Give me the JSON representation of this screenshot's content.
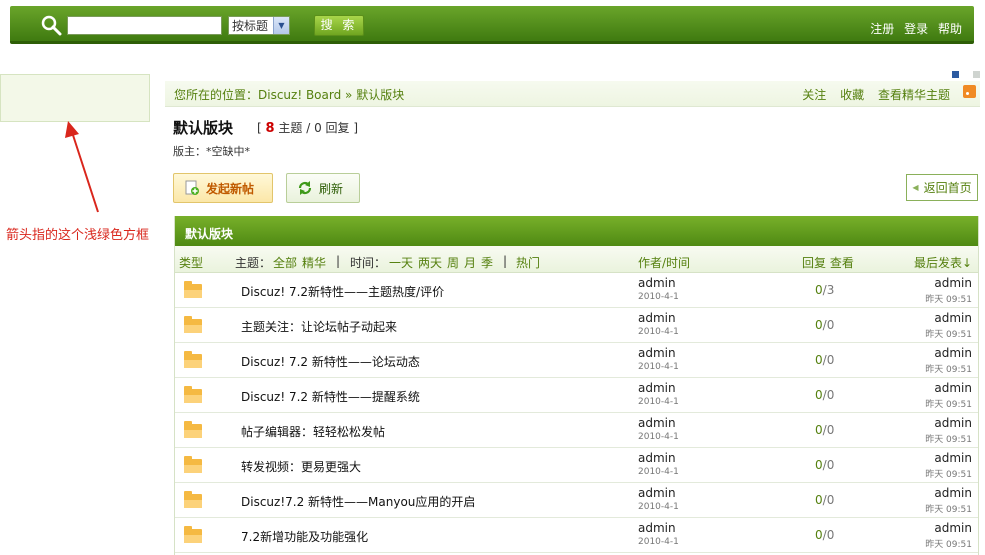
{
  "header": {
    "search_value": "",
    "search_select": "按标题",
    "search_button": "搜 索",
    "links": [
      "注册",
      "登录",
      "帮助"
    ]
  },
  "annotation": "箭头指的这个浅绿色方框",
  "breadcrumb": {
    "text": "您所在的位置：Discuz! Board » 默认版块",
    "actions": [
      "关注",
      "收藏",
      "查看精华主题"
    ]
  },
  "forum": {
    "title": "默认版块",
    "stats_prefix": "[",
    "topics": "8",
    "stats_middle": "主题 / 0 回复 ]",
    "moderator": "版主：*空缺中*"
  },
  "buttons": {
    "new_thread": "发起新帖",
    "refresh": "刷新",
    "back_home": "返回首页"
  },
  "table": {
    "head_title": "默认版块",
    "filter": {
      "type": "类型",
      "topic_label": "主题：",
      "all": "全部",
      "digest": "精华",
      "sep1": "|",
      "time_label": "时间：",
      "day": "一天",
      "two_days": "两天",
      "week": "周",
      "month": "月",
      "season": "季",
      "sep2": "|",
      "hot": "热门",
      "author_time": "作者/时间",
      "reply_view": "回复 查看",
      "last_post": "最后发表↓"
    },
    "rows": [
      {
        "subject": "Discuz! 7.2新特性——主题热度/评价",
        "author": "admin",
        "date": "2010-4-1",
        "replies": "0",
        "views": "3",
        "last_author": "admin",
        "last_date": "昨天 09:51"
      },
      {
        "subject": "主题关注：让论坛帖子动起来",
        "author": "admin",
        "date": "2010-4-1",
        "replies": "0",
        "views": "0",
        "last_author": "admin",
        "last_date": "昨天 09:51"
      },
      {
        "subject": "Discuz! 7.2 新特性——论坛动态",
        "author": "admin",
        "date": "2010-4-1",
        "replies": "0",
        "views": "0",
        "last_author": "admin",
        "last_date": "昨天 09:51"
      },
      {
        "subject": "Discuz! 7.2 新特性——提醒系统",
        "author": "admin",
        "date": "2010-4-1",
        "replies": "0",
        "views": "0",
        "last_author": "admin",
        "last_date": "昨天 09:51"
      },
      {
        "subject": "帖子编辑器：轻轻松松发帖",
        "author": "admin",
        "date": "2010-4-1",
        "replies": "0",
        "views": "0",
        "last_author": "admin",
        "last_date": "昨天 09:51"
      },
      {
        "subject": "转发视频：更易更强大",
        "author": "admin",
        "date": "2010-4-1",
        "replies": "0",
        "views": "0",
        "last_author": "admin",
        "last_date": "昨天 09:51"
      },
      {
        "subject": "Discuz!7.2 新特性——Manyou应用的开启",
        "author": "admin",
        "date": "2010-4-1",
        "replies": "0",
        "views": "0",
        "last_author": "admin",
        "last_date": "昨天 09:51"
      },
      {
        "subject": "7.2新增功能及功能强化",
        "author": "admin",
        "date": "2010-4-1",
        "replies": "0",
        "views": "0",
        "last_author": "admin",
        "last_date": "昨天 09:51"
      }
    ]
  },
  "colors": {
    "brand_green": "#4f8a13",
    "link_green": "#55800f",
    "annotation_red": "#d9261c",
    "light_green_box": "#f3f8e8"
  }
}
